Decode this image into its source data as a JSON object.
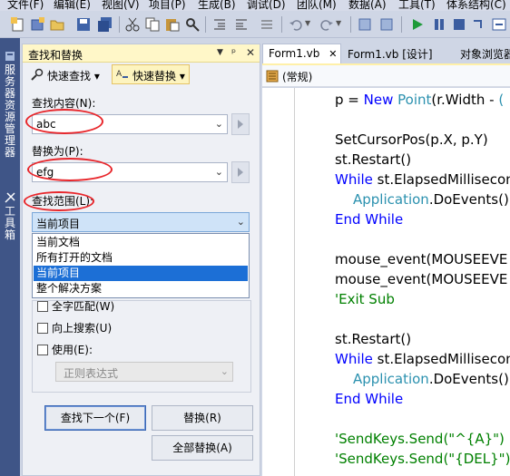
{
  "menu": [
    "文件(F)",
    "编辑(E)",
    "视图(V)",
    "项目(P)",
    "生成(B)",
    "调试(D)",
    "团队(M)",
    "数据(A)",
    "工具(T)",
    "体系结构(C)"
  ],
  "left_tabs": [
    "服务器资源管理器",
    "工具箱"
  ],
  "pane": {
    "title": "查找和替换",
    "pin": "ᵖ",
    "close": "✕",
    "dropdown_caret": "▼",
    "modes": {
      "quick_find": "快速查找",
      "quick_replace": "快速替换",
      "caret": "▾"
    },
    "find_label": "查找内容(N):",
    "find_value": "abc",
    "replace_label": "替换为(P):",
    "replace_value": "efg",
    "scope_label": "查找范围(L):",
    "scope_value": "当前项目",
    "scope_options": [
      "当前文档",
      "所有打开的文档",
      "当前项目",
      "整个解决方案"
    ],
    "scope_selected_index": 2,
    "options": {
      "match_word": "全字匹配(W)",
      "search_up": "向上搜索(U)",
      "use": "使用(E):",
      "regex": "正则表达式"
    },
    "buttons": {
      "find_next": "查找下一个(F)",
      "replace": "替换(R)",
      "replace_all": "全部替换(A)"
    }
  },
  "editor": {
    "tabs": [
      "Form1.vb",
      "Form1.vb [设计]",
      "对象浏览器"
    ],
    "tab_close": "✕",
    "nav_label": "(常规)",
    "code": {
      "l1": {
        "a": "p = ",
        "b": "New",
        "c": " ",
        "d": "Point",
        "e": "(r.Width - ",
        "f": "("
      },
      "l2": "SetCursorPos(p.X, p.Y)",
      "l3": "st.Restart()",
      "l4": {
        "kw": "While",
        "rest": " st.ElapsedMillisecon"
      },
      "l5": {
        "ty": "Application",
        "rest": ".DoEvents()"
      },
      "l6": "End While",
      "l7": "mouse_event(MOUSEEVE",
      "l8": "mouse_event(MOUSEEVE",
      "l9": "'Exit Sub",
      "l10": "st.Restart()",
      "l11": {
        "kw": "While",
        "rest": " st.ElapsedMillisecon"
      },
      "l12": {
        "ty": "Application",
        "rest": ".DoEvents()"
      },
      "l13": "End While",
      "l14": "'SendKeys.Send(\"^{A}\")",
      "l15": "'SendKeys.Send(\"{DEL}\")"
    }
  },
  "colors": {
    "annotation": "#e8262b",
    "keyword": "#0000ff",
    "type": "#2b91af",
    "comment": "#008000",
    "selection": "#1c6fd6"
  }
}
